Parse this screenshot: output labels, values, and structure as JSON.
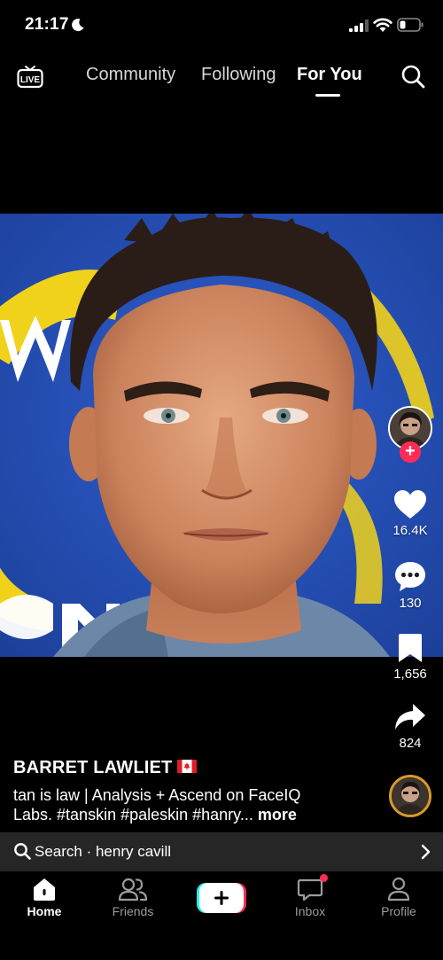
{
  "status_bar": {
    "time": "21:17"
  },
  "top_nav": {
    "live_label": "LIVE",
    "tabs": [
      {
        "label": "Community",
        "active": false
      },
      {
        "label": "Following",
        "active": false
      },
      {
        "label": "For You",
        "active": true
      }
    ]
  },
  "actions": {
    "likes": "16.4K",
    "comments": "130",
    "saves": "1,656",
    "shares": "824"
  },
  "post": {
    "author": "BARRET LAWLIET",
    "caption_line1": "tan is law | Analysis + Ascend on FaceIQ",
    "caption_line2": "Labs. #tanskin #paleskin #hanry...",
    "more_label": "more"
  },
  "search_suggestion": {
    "text": "Search · henry cavill"
  },
  "tabbar": {
    "home": "Home",
    "friends": "Friends",
    "inbox": "Inbox",
    "profile": "Profile"
  },
  "colors": {
    "accent_red": "#fe2c55",
    "accent_cyan": "#25f4ee",
    "background": "#000000",
    "search_bar_bg": "#262626"
  }
}
